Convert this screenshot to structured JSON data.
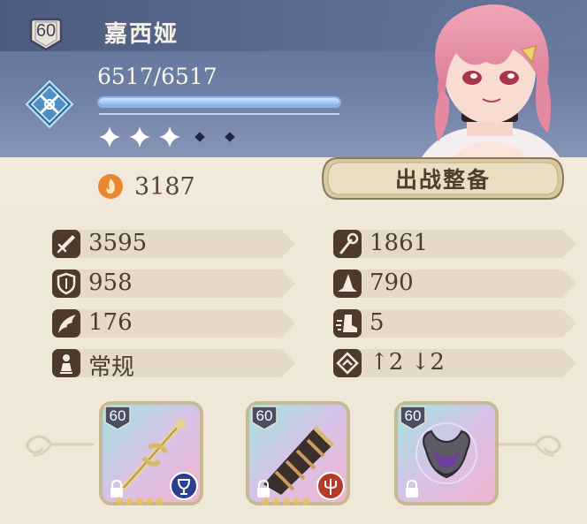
{
  "character": {
    "level": "60",
    "name": "嘉西娅",
    "hp_text": "6517/6517",
    "hp_fraction": 1.0,
    "star_rank": 3,
    "star_max": 5,
    "power": "3187",
    "deploy_label": "出战整备"
  },
  "stats": [
    {
      "icon": "sword-icon",
      "value": "3595"
    },
    {
      "icon": "staff-icon",
      "value": "1861"
    },
    {
      "icon": "shield-icon",
      "value": "958"
    },
    {
      "icon": "wizard-hat-icon",
      "value": "790"
    },
    {
      "icon": "wing-icon",
      "value": "176"
    },
    {
      "icon": "boot-icon",
      "value": "5"
    },
    {
      "icon": "person-icon",
      "value": "常规"
    },
    {
      "icon": "range-icon",
      "value": "↑2 ↓2"
    }
  ],
  "equipment": [
    {
      "level": "60",
      "item": "golden-sword-icon",
      "badge": "chalice-icon",
      "badge_color": "#2c3f8c",
      "stars": 5
    },
    {
      "level": "60",
      "item": "gauntlet-icon",
      "badge": "trident-icon",
      "badge_color": "#b63a26",
      "stars": 5
    },
    {
      "level": "60",
      "item": "bat-emblem-icon",
      "badge": "",
      "badge_color": "",
      "stars": 0
    }
  ],
  "colors": {
    "header_blue": "#5b6c92",
    "panel_cream": "#efe7d8",
    "text_brown": "#4a3d33",
    "hp_fill": "#8fb8ef",
    "button_gold": "#d8c9a4",
    "icon_brown": "#4d3a2c"
  }
}
